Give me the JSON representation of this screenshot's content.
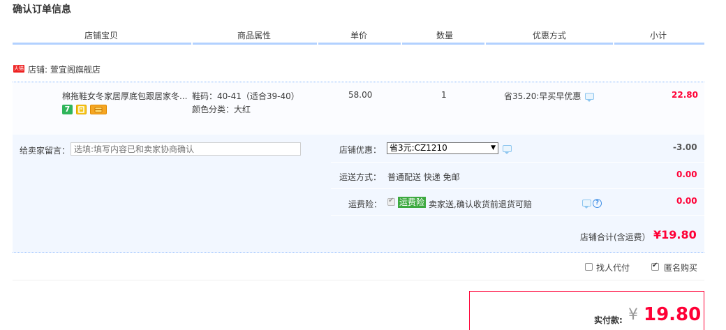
{
  "page": {
    "title": "确认订单信息"
  },
  "columns": [
    "店铺宝贝",
    "商品属性",
    "单价",
    "数量",
    "优惠方式",
    "小计"
  ],
  "shop": {
    "badge": "天猫",
    "label": "店铺: 萱宜阁旗舰店"
  },
  "item": {
    "name": "棉拖鞋女冬家居厚底包跟居家冬...",
    "attr_size": "鞋码：40-41（适合39-40）",
    "attr_color": "颜色分类：大红",
    "price": "58.00",
    "quantity": "1",
    "discount": "省35.20:早买早优惠",
    "subtotal": "22.80",
    "badge_seven": "7"
  },
  "message": {
    "label": "给卖家留言：",
    "placeholder": "选填:填写内容已和卖家协商确认"
  },
  "shop_discount": {
    "label": "店铺优惠：",
    "selected": "省3元:CZ1210",
    "amount": "-3.00"
  },
  "shipping": {
    "label": "运送方式：",
    "value": "普通配送 快递 免邮",
    "amount": "0.00"
  },
  "insurance": {
    "label": "运费险：",
    "tag": "运费险",
    "desc": "卖家送,确认收货前退货可赔",
    "amount": "0.00"
  },
  "shop_total": {
    "label": "店铺合计(含运费）",
    "value": "¥19.80"
  },
  "options": {
    "proxy_pay": "找人代付",
    "anonymous": "匿名购买"
  },
  "payment": {
    "label": "实付款:",
    "currency": "¥",
    "value": "19.80"
  },
  "colors": {
    "accent_red": "#ff0036",
    "header_border": "#b2d1ff",
    "panel_bg": "#f2f7ff"
  }
}
